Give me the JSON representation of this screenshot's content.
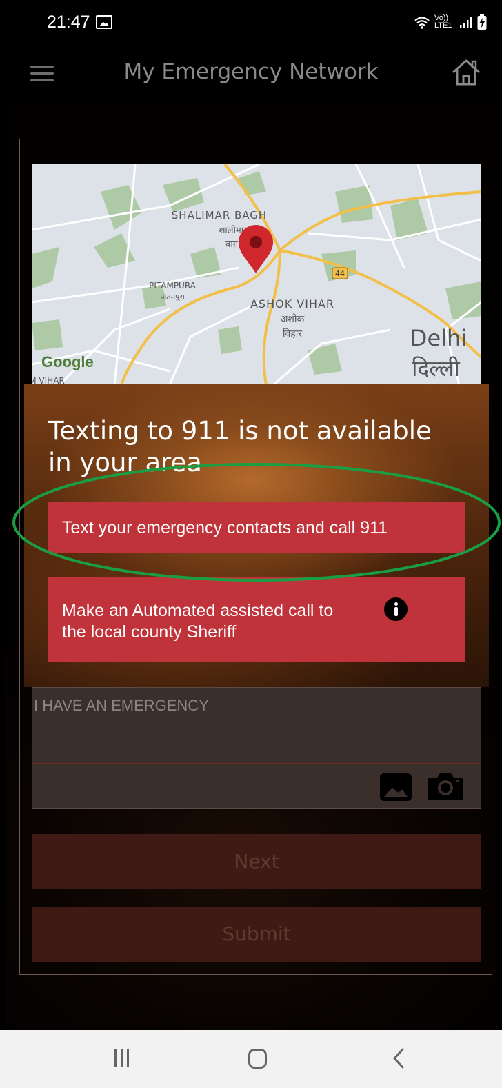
{
  "status_bar": {
    "time": "21:47",
    "network_label": "Vo)) LTE1",
    "icons": [
      "image-icon",
      "wifi-icon",
      "signal-icon",
      "battery-charging-icon"
    ]
  },
  "header": {
    "title": "My Emergency Network",
    "menu_icon": "hamburger-menu-icon",
    "home_icon": "home-icon"
  },
  "map": {
    "labels": {
      "shalimar_bagh": "SHALIMAR BAGH",
      "shalimar_bagh_hi_1": "शालीमार",
      "shalimar_bagh_hi_2": "बाग़",
      "pitampura": "PITAMPURA",
      "pitampura_hi": "पीतमपुरा",
      "ashok_vihar": "ASHOK VIHAR",
      "ashok_vihar_hi_1": "अशोक",
      "ashok_vihar_hi_2": "विहार",
      "delhi": "Delhi",
      "delhi_hi": "दिल्ली",
      "route_shield": "44",
      "google": "Google",
      "partial_label": "M VIHAR"
    }
  },
  "dialog": {
    "title": "Texting to 911 is not available in your area",
    "buttons": [
      {
        "label": "Text your emergency contacts and call 911"
      },
      {
        "label_line1": "Make an Automated assisted call to",
        "label_line2": "the local county Sheriff",
        "icon": "info-icon"
      }
    ]
  },
  "message": {
    "text": "I HAVE AN EMERGENCY",
    "attach_icons": [
      "gallery-icon",
      "camera-icon"
    ]
  },
  "actions": {
    "next_label": "Next",
    "submit_label": "Submit"
  },
  "nav_bar": {
    "icons": [
      "recent-apps-icon",
      "home-circle-icon",
      "back-icon"
    ]
  },
  "colors": {
    "dialog_button": "#c0333a",
    "highlight": "#1a9e44",
    "disabled_button": "#3f1a14"
  }
}
